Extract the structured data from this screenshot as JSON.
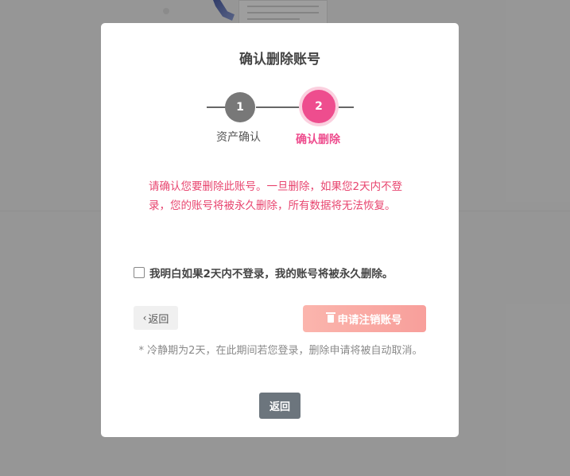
{
  "modal": {
    "title": "确认删除账号",
    "steps": [
      {
        "number": "1",
        "label": "资产确认",
        "state": "done"
      },
      {
        "number": "2",
        "label": "确认删除",
        "state": "active"
      }
    ],
    "warning": "请确认您要删除此账号。一旦删除，如果您2天内不登录，您的账号将被永久删除，所有数据将无法恢复。",
    "acknowledge": {
      "label": "我明白如果2天内不登录，我的账号将被永久删除。",
      "checked": false
    },
    "back_button": "返回",
    "request_button": "申请注销账号",
    "request_icon": "trash-icon",
    "note": "* 冷静期为2天，在此期间若您登录，删除申请将被自动取消。",
    "close_button": "返回"
  },
  "colors": {
    "accent": "#ee4d8e",
    "warning_text": "#e8456f",
    "request_button": "#f89f9b",
    "close_button": "#6c757d"
  }
}
